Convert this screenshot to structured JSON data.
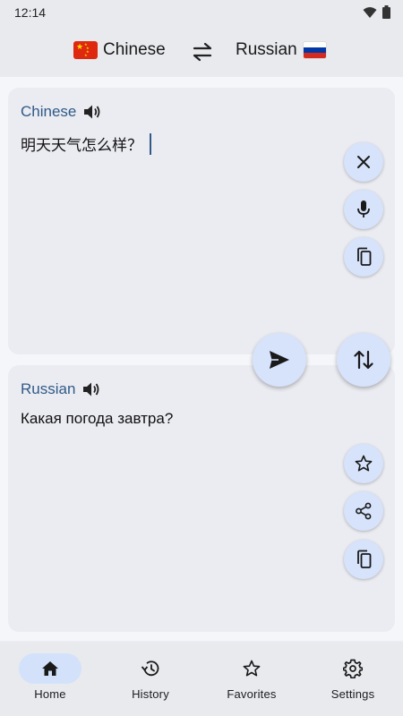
{
  "status": {
    "time": "12:14"
  },
  "languages": {
    "source": "Chinese",
    "target": "Russian"
  },
  "source_card": {
    "label": "Chinese",
    "text": "明天天气怎么样？"
  },
  "target_card": {
    "label": "Russian",
    "text": "Какая погода завтра?"
  },
  "nav": [
    {
      "label": "Home",
      "icon": "home-icon",
      "active": true
    },
    {
      "label": "History",
      "icon": "history-icon",
      "active": false
    },
    {
      "label": "Favorites",
      "icon": "star-icon",
      "active": false
    },
    {
      "label": "Settings",
      "icon": "gear-icon",
      "active": false
    }
  ],
  "colors": {
    "accent": "#2f5a86",
    "fab": "#d6e3fb",
    "card": "#ebecf2",
    "nav_active": "#d3e2fa"
  }
}
